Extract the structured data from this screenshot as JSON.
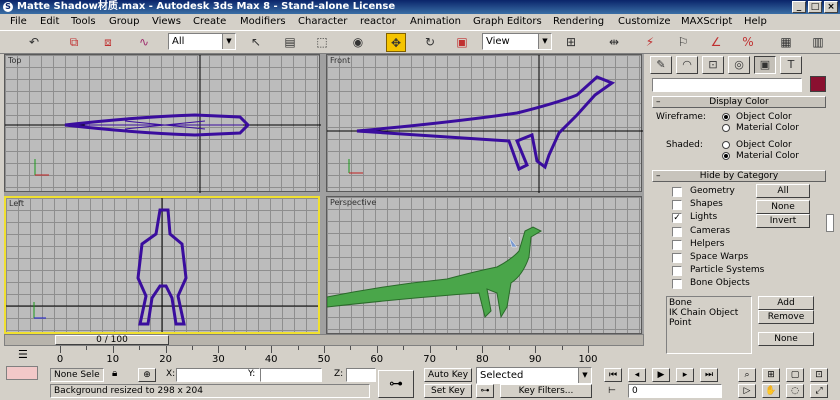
{
  "window": {
    "title": "Matte Shadow材质.max - Autodesk 3ds Max 8 - Stand-alone License",
    "min": "_",
    "max": "□",
    "close": "×"
  },
  "menu": [
    "File",
    "Edit",
    "Tools",
    "Group",
    "Views",
    "Create",
    "Modifiers",
    "Character",
    "reactor",
    "Animation",
    "Graph Editors",
    "Rendering",
    "Customize",
    "MAXScript",
    "Help"
  ],
  "toolbar": {
    "selection_filter": "All",
    "reference_coord": "View",
    "icons": [
      "undo-icon",
      "select-link-icon",
      "unlink-icon",
      "bind-spacewarp-icon",
      "select-icon",
      "select-by-name-icon",
      "rect-region-icon",
      "window-crossing-icon",
      "move-icon",
      "rotate-icon",
      "scale-icon",
      "pivot-icon",
      "mirror-icon",
      "align-icon",
      "snap-icon",
      "angle-snap-icon",
      "percent-snap-icon",
      "spinner-snap-icon",
      "named-selection-icon",
      "material-editor-icon",
      "render-icon"
    ]
  },
  "viewports": {
    "top_label": "Top",
    "front_label": "Front",
    "left_label": "Left",
    "persp_label": "Perspective"
  },
  "panel": {
    "display_color": {
      "header": "Display Color",
      "wireframe_label": "Wireframe:",
      "shaded_label": "Shaded:",
      "object_color": "Object Color",
      "material_color": "Material Color"
    },
    "hide_by_category": {
      "header": "Hide by Category",
      "categories": [
        {
          "label": "Geometry",
          "checked": false
        },
        {
          "label": "Shapes",
          "checked": false
        },
        {
          "label": "Lights",
          "checked": true
        },
        {
          "label": "Cameras",
          "checked": false
        },
        {
          "label": "Helpers",
          "checked": false
        },
        {
          "label": "Space Warps",
          "checked": false
        },
        {
          "label": "Particle Systems",
          "checked": false
        },
        {
          "label": "Bone Objects",
          "checked": false
        }
      ],
      "all": "All",
      "none": "None",
      "invert": "Invert",
      "list": [
        "Bone",
        "IK Chain Object",
        "Point"
      ],
      "add": "Add",
      "remove": "Remove",
      "none2": "None"
    }
  },
  "timeline": {
    "position": "0 / 100",
    "ticks": [
      "0",
      "10",
      "20",
      "30",
      "40",
      "50",
      "60",
      "70",
      "80",
      "90",
      "100"
    ]
  },
  "status": {
    "selection": "None Sele",
    "x_label": "X:",
    "y_label": "Y:",
    "z_label": "Z:",
    "auto_key": "Auto Key",
    "set_key": "Set Key",
    "selected": "Selected",
    "key_filters": "Key Filters...",
    "prompt": "Background resized to 298 x 204",
    "frame": "0",
    "accent": "#f5c400",
    "active_viewport": "#f0e030",
    "dino_wire": "#3a0d9e",
    "dino_green": "#4aa64a"
  }
}
